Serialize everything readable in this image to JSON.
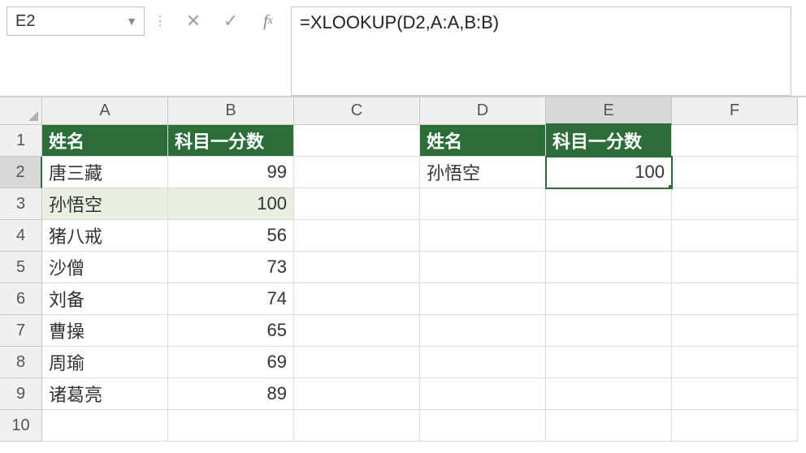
{
  "name_box": {
    "value": "E2"
  },
  "formula_bar": {
    "fx_label": "f",
    "fx_sub": "x",
    "value": "=XLOOKUP(D2,A:A,B:B)"
  },
  "columns": [
    "A",
    "B",
    "C",
    "D",
    "E",
    "F"
  ],
  "active_col": "E",
  "active_row": 2,
  "headers": {
    "ab_name": "姓名",
    "ab_score": "科目一分数",
    "de_name": "姓名",
    "de_score": "科目一分数"
  },
  "data_ab": [
    {
      "name": "唐三藏",
      "score": "99"
    },
    {
      "name": "孙悟空",
      "score": "100"
    },
    {
      "name": "猪八戒",
      "score": "56"
    },
    {
      "name": "沙僧",
      "score": "73"
    },
    {
      "name": "刘备",
      "score": "74"
    },
    {
      "name": "曹操",
      "score": "65"
    },
    {
      "name": "周瑜",
      "score": "69"
    },
    {
      "name": "诸葛亮",
      "score": "89"
    }
  ],
  "data_de": [
    {
      "name": "孙悟空",
      "score": "100"
    }
  ],
  "row_count": 10
}
